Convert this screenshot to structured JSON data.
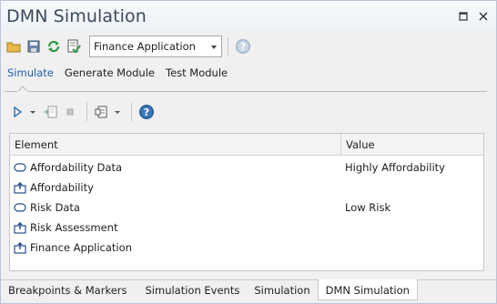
{
  "window": {
    "title": "DMN Simulation"
  },
  "toolbar": {
    "model_select_value": "Finance Application"
  },
  "tabs": [
    {
      "label": "Simulate"
    },
    {
      "label": "Generate Module"
    },
    {
      "label": "Test Module"
    }
  ],
  "grid": {
    "columns": [
      "Element",
      "Value"
    ],
    "rows": [
      {
        "element": "Affordability Data",
        "value": "Highly Affordability",
        "icon": "input-data-icon"
      },
      {
        "element": "Affordability",
        "value": "",
        "icon": "decision-icon"
      },
      {
        "element": "Risk Data",
        "value": "Low Risk",
        "icon": "input-data-icon"
      },
      {
        "element": "Risk Assessment",
        "value": "",
        "icon": "decision-icon"
      },
      {
        "element": "Finance Application",
        "value": "",
        "icon": "decision-icon"
      }
    ]
  },
  "bottom_tabs": [
    {
      "label": "Breakpoints & Markers"
    },
    {
      "label": "Simulation Events"
    },
    {
      "label": "Simulation"
    },
    {
      "label": "DMN Simulation"
    }
  ],
  "colors": {
    "accent": "#1e5fa8",
    "title": "#3b4a5c"
  }
}
